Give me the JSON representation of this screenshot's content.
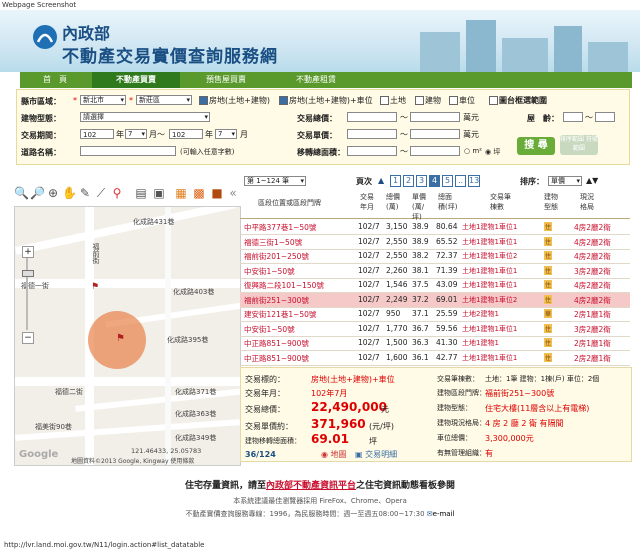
{
  "window": {
    "caption": "Webpage Screenshot",
    "status_url": "http://lvr.land.moi.gov.tw/N11/login.action#list_datatable"
  },
  "header": {
    "org": "內政部",
    "site_title": "不動產交易實價查詢服務網"
  },
  "nav": {
    "tabs": [
      "首　頁",
      "不動產買賣",
      "預售屋買賣",
      "不動產租賃"
    ],
    "active": 1
  },
  "search": {
    "county_label": "縣市區域：",
    "county_value": "新北市",
    "district_value": "新莊區",
    "types": [
      {
        "label": "房地(土地+建物)",
        "checked": true
      },
      {
        "label": "房地(土地+建物)+車位",
        "checked": true
      },
      {
        "label": "土地",
        "checked": false
      },
      {
        "label": "建物",
        "checked": false
      },
      {
        "label": "車位",
        "checked": false
      }
    ],
    "map_range_label": "圖台框選範圍",
    "building_type_label": "建物型態：",
    "building_type_value": "請選擇",
    "total_price_label": "交易總價：",
    "total_price_unit": "萬元",
    "age_label": "屋　齡：",
    "period_label": "交易期間：",
    "period_from_year": "102",
    "period_from_month": "7",
    "period_to_year": "102",
    "period_to_month": "7",
    "year_unit": "年",
    "month_unit": "月",
    "month_sep": "月～",
    "unit_price_label": "交易單價：",
    "unit_price_unit": "萬元",
    "road_label": "道路名稱：",
    "road_hint": "(可輸入任意字數)",
    "area_label": "移轉總面積：",
    "area_unit_m2": "m²",
    "area_unit_ping": "坪",
    "search_button": "搜 尋",
    "clear_button": "排序範圍 符號範圍"
  },
  "map": {
    "roads": [
      "化成路431巷",
      "化成路403巷",
      "化成路395巷",
      "化成路371巷",
      "化成路363巷",
      "化成路349巷",
      "福前街",
      "福德二街",
      "福德一街",
      "福美街90巷"
    ],
    "scale_text": "121.46433, 25.05783",
    "attribution": "地圖資料©2013 Google, Kingway 使用條款",
    "google_logo": "Google"
  },
  "results": {
    "page_select": "第 1~124 筆",
    "page_label": "頁次",
    "pages": [
      "1",
      "2",
      "3",
      "4",
      "5",
      "..",
      "13"
    ],
    "current_page": "4",
    "sort_label": "排序：",
    "sort_value": "單價",
    "columns": [
      "區段位置或區段門牌",
      "交易年月",
      "總價(萬)",
      "單價(萬/坪)",
      "總面積(坪)",
      "交易筆棟數",
      "建物型態",
      "現況格局"
    ],
    "rows": [
      [
        "中平路377巷1~50號",
        "102/7",
        "3,150",
        "38.9",
        "80.64",
        "土地1建物1車位1",
        "住",
        "4房2廳2衛"
      ],
      [
        "福德三街1~50號",
        "102/7",
        "2,550",
        "38.9",
        "65.52",
        "土地1建物1車位1",
        "住",
        "4房2廳2衛"
      ],
      [
        "福前街201~250號",
        "102/7",
        "2,550",
        "38.2",
        "72.37",
        "土地1建物1車位2",
        "住",
        "4房2廳2衛"
      ],
      [
        "中安街1~50號",
        "102/7",
        "2,260",
        "38.1",
        "71.39",
        "土地1建物1車位1",
        "住",
        "3房2廳2衛"
      ],
      [
        "復興路二段101~150號",
        "102/7",
        "1,546",
        "37.5",
        "43.09",
        "土地1建物1車位1",
        "住",
        "4房2廳2衛"
      ],
      [
        "福前街251~300號",
        "102/7",
        "2,249",
        "37.2",
        "69.01",
        "土地1建物1車位2",
        "住",
        "4房2廳2衛"
      ],
      [
        "建安街121巷1~50號",
        "102/7",
        "950",
        "37.1",
        "25.59",
        "土地2建物1",
        "華",
        "2房1廳1衛"
      ],
      [
        "中安街1~50號",
        "102/7",
        "1,770",
        "36.7",
        "59.56",
        "土地1建物1車位1",
        "住",
        "3房2廳2衛"
      ],
      [
        "中正路851~900號",
        "102/7",
        "1,500",
        "36.3",
        "41.30",
        "土地1建物1",
        "住",
        "2房1廳1衛"
      ],
      [
        "中正路851~900號",
        "102/7",
        "1,600",
        "36.1",
        "42.77",
        "土地1建物1車位1",
        "住",
        "2房2廳1衛"
      ]
    ],
    "highlight_row": 5
  },
  "detail": {
    "target_label": "交易標的：",
    "target_value": "房地(土地+建物)+車位",
    "date_label": "交易年月：",
    "date_value": "102年7月",
    "total_label": "交易總價：",
    "total_value": "22,490,000",
    "total_unit": "元",
    "unit_label": "交易單價約：",
    "unit_value": "371,960",
    "unit_unit": "(元/坪)",
    "area_label": "建物移轉總面積：",
    "area_value": "69.01",
    "area_unit": "坪",
    "count_label": "交易筆棟數：",
    "count_value": "土地：1筆 建物：1棟(戶) 車位：2個",
    "addr_label": "建物區段門牌：",
    "addr_value": "福前街251~300號",
    "type_label": "建物型態：",
    "type_value": "住宅大樓(11層含以上有電梯)",
    "layout_label": "建物現況格局：",
    "layout_value": "4 房 2 廳 2 衛 有隔間",
    "parking_label": "車位總價：",
    "parking_value": "3,300,000元",
    "mgmt_label": "有無管理組織：",
    "mgmt_value": "有",
    "counter": "36/124",
    "map_link": "地圖",
    "trans_link": "交易明細"
  },
  "footer": {
    "line1_pre": "住宅存量資訊，請至",
    "line1_link": "內政部不動產資訊平台",
    "line1_post": "之住宅資訊動態看板參閱",
    "line2": "本系統建議最佳瀏覽器採用 FireFox、Chrome、Opera",
    "line3": "不動產實價查詢服務專線：1996，為民服務時間：週一至週五08:00~17:30",
    "email": "e-mail"
  },
  "colors": {
    "nav_green": "#5a9a2c",
    "link_red": "#c8102e",
    "title_blue": "#1a4f84"
  }
}
